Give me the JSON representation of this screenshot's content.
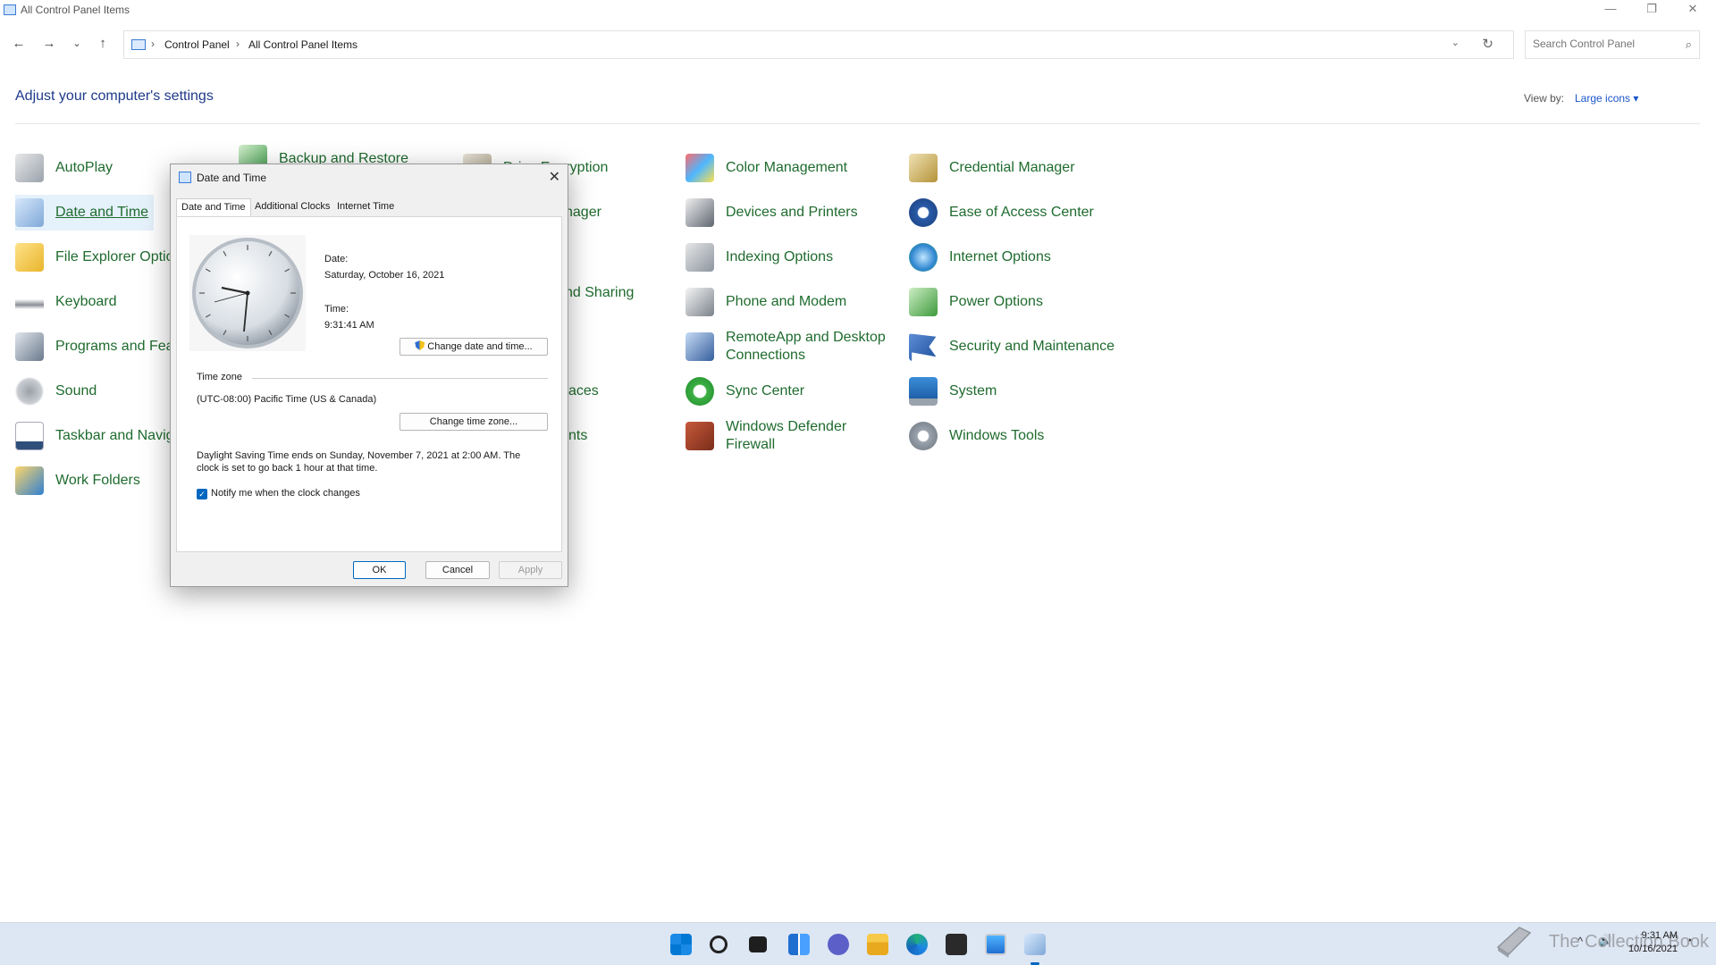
{
  "window": {
    "title": "All Control Panel Items",
    "minimize": "—",
    "maximize": "❐",
    "close": "✕"
  },
  "nav": {
    "back": "←",
    "forward": "→",
    "recent": "⌄",
    "up": "↑"
  },
  "address": {
    "crumbs": [
      "Control Panel",
      "All Control Panel Items"
    ],
    "separator": "›",
    "dropdown": "⌄",
    "refresh": "↻"
  },
  "search": {
    "placeholder": "Search Control Panel",
    "icon": "⌕"
  },
  "header": {
    "title": "Adjust your computer's settings",
    "view_by_label": "View by:",
    "view_by_value": "Large icons ▾"
  },
  "items": {
    "autoplay": "AutoPlay",
    "backup": "Backup and Restore",
    "bitlocker": "Drive Encryption",
    "color": "Color Management",
    "credential": "Credential Manager",
    "datetime": "Date and Time",
    "devmgr": "nager",
    "devices": "Devices and Printers",
    "ease": "Ease of Access Center",
    "fileexplorer": "File Explorer Optio",
    "indexing": "Indexing Options",
    "internet": "Internet Options",
    "network": "nd Sharing",
    "keyboard": "Keyboard",
    "phone": "Phone and Modem",
    "power": "Power Options",
    "programs": "Programs and Feat",
    "remoteapp_1": "RemoteApp and Desktop",
    "remoteapp_2": "Connections",
    "security": "Security and Maintenance",
    "sound": "Sound",
    "spaces": "aces",
    "sync": "Sync Center",
    "system": "System",
    "taskbar": "Taskbar and Navig",
    "accounts": "nts",
    "defender_1": "Windows Defender",
    "defender_2": "Firewall",
    "tools": "Windows Tools",
    "workfolders": "Work Folders"
  },
  "dialog": {
    "title": "Date and Time",
    "close": "✕",
    "tabs": [
      "Date and Time",
      "Additional Clocks",
      "Internet Time"
    ],
    "date_label": "Date:",
    "date_value": "Saturday, October 16, 2021",
    "time_label": "Time:",
    "time_value": "9:31:41 AM",
    "change_datetime": "Change date and time...",
    "timezone_label": "Time zone",
    "timezone_value": "(UTC-08:00) Pacific Time (US & Canada)",
    "change_timezone": "Change time zone...",
    "dst_line1": "Daylight Saving Time ends on Sunday, November 7, 2021 at 2:00 AM. The",
    "dst_line2": "clock is set to go back 1 hour at that time.",
    "notify_label": "Notify me when the clock changes",
    "notify_checked": true,
    "ok": "OK",
    "cancel": "Cancel",
    "apply": "Apply"
  },
  "taskbar": {
    "watermark": "The Collection Book",
    "time": "9:31 AM",
    "date": "10/16/2021",
    "tray_chevron": "^",
    "tray_volume": "🔊",
    "tray_notify": "◔"
  },
  "colors": {
    "link_green": "#1f6b2e",
    "heading_blue": "#1e3a8a",
    "accent": "#0067c0",
    "taskbar_bg": "#dde6f3"
  }
}
